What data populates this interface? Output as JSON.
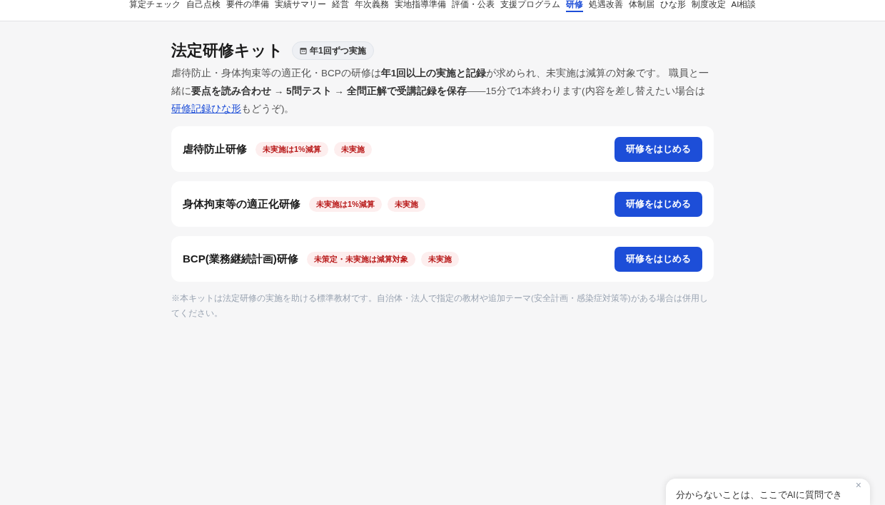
{
  "nav": {
    "items": [
      {
        "label": "算定チェック",
        "selected": false
      },
      {
        "label": "自己点検",
        "selected": false
      },
      {
        "label": "要件の準備",
        "selected": false
      },
      {
        "label": "実績サマリー",
        "selected": false
      },
      {
        "label": "経営",
        "selected": false
      },
      {
        "label": "年次義務",
        "selected": false
      },
      {
        "label": "実地指導準備",
        "selected": false
      },
      {
        "label": "評価・公表",
        "selected": false
      },
      {
        "label": "支援プログラム",
        "selected": false
      },
      {
        "label": "研修",
        "selected": true
      },
      {
        "label": "処遇改善",
        "selected": false
      },
      {
        "label": "体制届",
        "selected": false
      },
      {
        "label": "ひな形",
        "selected": false
      },
      {
        "label": "制度改定",
        "selected": false
      },
      {
        "label": "AI相談",
        "selected": false
      }
    ]
  },
  "header": {
    "title": "法定研修キット",
    "badge": "年1回ずつ実施"
  },
  "intro": {
    "text": "虐待防止・身体拘束等の適正化・BCPの研修は**年1回以上の実施と記録**が求められ、未実施は減算の対象です。 職員と一緒に**要点を読み合わせ → 5問テスト → 全問正解で受講記録を保存**——15分で1本終わります(内容を差し替えたい場合は",
    "link": "研修記録ひな形",
    "text_after": "もどうぞ)。"
  },
  "trainings": [
    {
      "title": "虐待防止研修",
      "tags": [
        "未実施は1%減算",
        "未実施"
      ],
      "button": "研修をはじめる"
    },
    {
      "title": "身体拘束等の適正化研修",
      "tags": [
        "未実施は1%減算",
        "未実施"
      ],
      "button": "研修をはじめる"
    },
    {
      "title": "BCP(業務継続計画)研修",
      "tags": [
        "未策定・未実施は減算対象",
        "未実施"
      ],
      "button": "研修をはじめる"
    }
  ],
  "note": "※本キットは法定研修の実施を助ける標準教材です。自治体・法人で指定の教材や追加テーマ(安全計画・感染症対策等)がある場合は併用してください。",
  "chat_popup": {
    "text": "分からないことは、ここでAIに質問でき",
    "close": "×"
  }
}
